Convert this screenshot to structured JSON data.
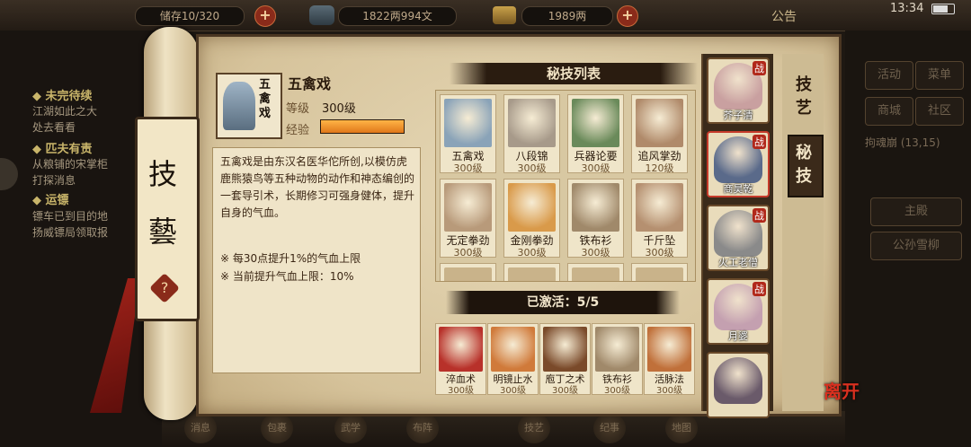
{
  "status_bar": {
    "left_counter": "储存10/320",
    "copper": "1822两994文",
    "silver": "1989两",
    "notice": "公告",
    "time": "13:34"
  },
  "left_panel": {
    "quests": [
      {
        "header": "◆ 未完待续",
        "lines": [
          "江湖如此之大",
          "处去看看"
        ]
      },
      {
        "header": "◆ 匹夫有责",
        "lines": [
          "从粮铺的宋掌柜",
          "打探消息"
        ]
      },
      {
        "header": "◆ 运镖",
        "lines": [
          "镖车已到目的地",
          "扬威镖局领取报"
        ]
      }
    ]
  },
  "right_panel": {
    "buttons": [
      "活动",
      "菜单",
      "商城",
      "社区"
    ],
    "location": "拘魂崩 (13,15)",
    "main_hall": "主殿",
    "npc": "公孙雪柳"
  },
  "scroll": {
    "label_top": "技",
    "label_bottom": "藝",
    "help": "?"
  },
  "skill_detail": {
    "name": "五禽戏",
    "level_label": "等级",
    "level_value": "300级",
    "exp_label": "经验",
    "exp_fill": 1.0,
    "description": "五禽戏是由东汉名医华佗所创,以模仿虎鹿熊猿鸟等五种动物的动作和神态编创的一套导引术，长期修习可强身健体，提升自身的气血。",
    "note1": "※ 每30点提升1%的气血上限",
    "note2": "※ 当前提升气血上限：10%"
  },
  "secret_list": {
    "title": "秘技列表",
    "items": [
      {
        "name": "五禽戏",
        "level": "300级",
        "color": "#8aa3b8"
      },
      {
        "name": "八段锦",
        "level": "300级",
        "color": "#a79a8a"
      },
      {
        "name": "兵器论要",
        "level": "300级",
        "color": "#6a8a5a"
      },
      {
        "name": "追风掌劲",
        "level": "120级",
        "color": "#b08a6a"
      },
      {
        "name": "无定拳劲",
        "level": "300级",
        "color": "#b89a7a"
      },
      {
        "name": "金刚拳劲",
        "level": "300级",
        "color": "#d99a4a"
      },
      {
        "name": "铁布衫",
        "level": "300级",
        "color": "#a0896a"
      },
      {
        "name": "千斤坠",
        "level": "300级",
        "color": "#b59070"
      }
    ]
  },
  "activated": {
    "label": "已激活：5/5",
    "items": [
      {
        "name": "淬血术",
        "level": "300级",
        "color": "#b8312a"
      },
      {
        "name": "明镜止水",
        "level": "300级",
        "color": "#d07a3a"
      },
      {
        "name": "庖丁之术",
        "level": "300级",
        "color": "#7a4a2a"
      },
      {
        "name": "铁布衫",
        "level": "300级",
        "color": "#a0896a"
      },
      {
        "name": "活脉法",
        "level": "300级",
        "color": "#c0703a"
      }
    ]
  },
  "heroes": [
    {
      "name": "芥子清",
      "tag": "战",
      "color": "#c9a0a0"
    },
    {
      "name": "商昊乾",
      "tag": "战",
      "color": "#5a6a8a"
    },
    {
      "name": "火工老僧",
      "tag": "战",
      "color": "#8a8a8a"
    },
    {
      "name": "月婆",
      "tag": "战",
      "color": "#c4a0b0"
    },
    {
      "name": "",
      "tag": "",
      "color": "#6a5a6a"
    }
  ],
  "side_tabs": {
    "skills": "技艺",
    "secret": "秘技"
  },
  "leave": "离开",
  "bottom_nav": [
    "消息",
    "包裹",
    "武学",
    "布阵",
    "技艺",
    "纪事",
    "地图"
  ]
}
